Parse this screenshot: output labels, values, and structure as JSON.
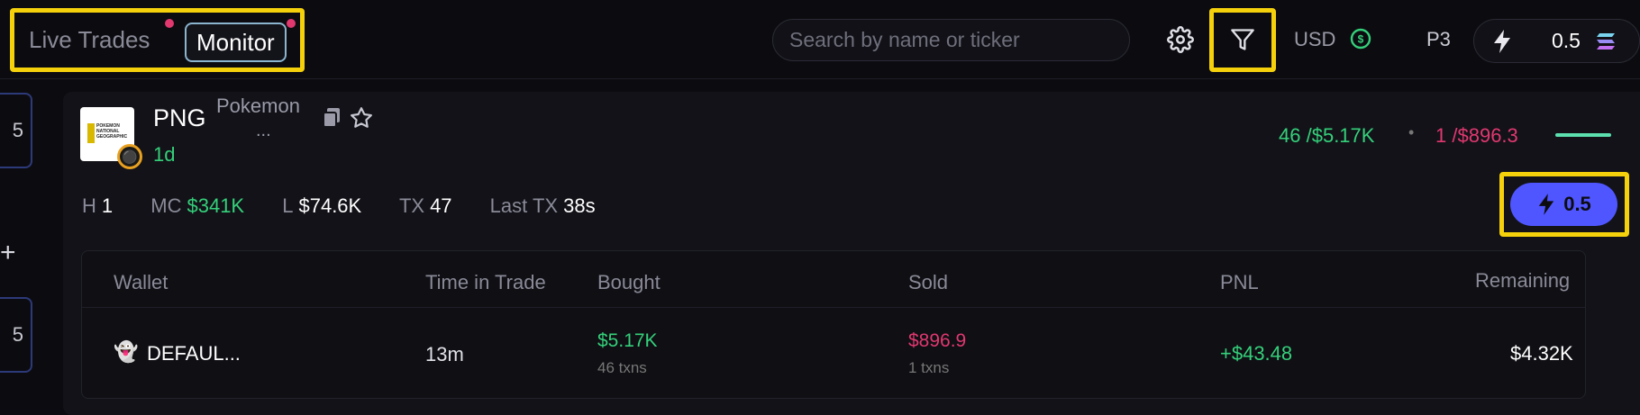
{
  "header": {
    "tabs": [
      {
        "label": "Live Trades"
      },
      {
        "label": "Monitor"
      }
    ],
    "search": {
      "placeholder": "Search by name or ticker"
    },
    "currency": "USD",
    "preset": "P3",
    "quick_buy_amount": "0.5"
  },
  "sidebar": {
    "items": [
      {
        "label": "5"
      },
      {
        "label": "+"
      },
      {
        "label": "5"
      }
    ]
  },
  "token": {
    "ticker": "PNG",
    "name": "Pokemon",
    "name_truncated": "...",
    "age": "1d",
    "logo_text": "POKEMON NATIONAL GEOGRAPHIC",
    "buys_count": "46",
    "buys_value": "/$5.17K",
    "sells_count": "1",
    "sells_value": "/$896.3",
    "stats": {
      "h_label": "H",
      "h_value": "1",
      "mc_label": "MC",
      "mc_value": "$341K",
      "l_label": "L",
      "l_value": "$74.6K",
      "tx_label": "TX",
      "tx_value": "47",
      "last_tx_label": "Last TX",
      "last_tx_value": "38s"
    },
    "quick_buy": "0.5"
  },
  "table": {
    "columns": [
      "Wallet",
      "Time in Trade",
      "Bought",
      "Sold",
      "PNL",
      "Remaining"
    ],
    "rows": [
      {
        "wallet_icon": "ghost",
        "wallet": "DEFAUL...",
        "time": "13m",
        "bought": "$5.17K",
        "bought_txns": "46 txns",
        "sold": "$896.9",
        "sold_txns": "1 txns",
        "pnl": "+$43.48",
        "remaining": "$4.32K"
      }
    ]
  },
  "colors": {
    "accent": "#4f56ff",
    "positive": "#35d07a",
    "negative": "#e0386f",
    "highlight": "#f5d10c"
  }
}
